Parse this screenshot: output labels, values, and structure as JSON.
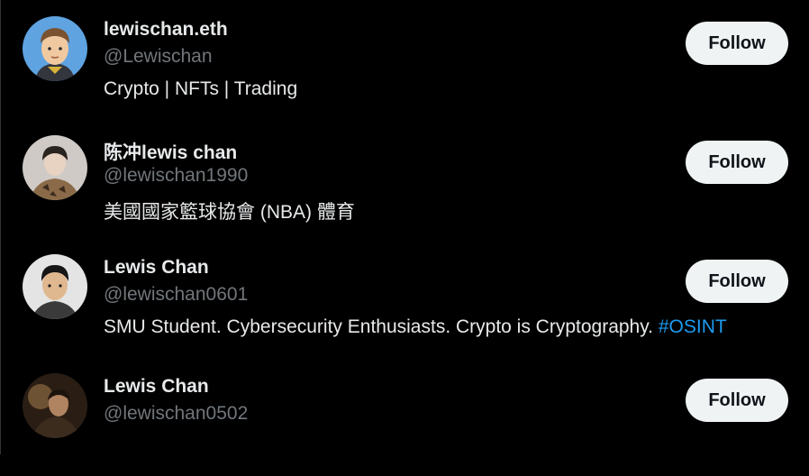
{
  "users": [
    {
      "display_name": "lewischan.eth",
      "handle": "@Lewischan",
      "bio": "Crypto | NFTs | Trading",
      "follow_label": "Follow"
    },
    {
      "display_name": "陈冲lewis chan",
      "handle": "@lewischan1990",
      "bio": "美國國家籃球協會 (NBA) 體育",
      "follow_label": "Follow"
    },
    {
      "display_name": "Lewis Chan",
      "handle": "@lewischan0601",
      "bio": "SMU Student. Cybersecurity Enthusiasts. Crypto is Cryptography. ",
      "bio_hashtag": "#OSINT",
      "follow_label": "Follow"
    },
    {
      "display_name": "Lewis Chan",
      "handle": "@lewischan0502",
      "follow_label": "Follow"
    }
  ],
  "colors": {
    "background": "#000000",
    "primary_text": "#e7e9ea",
    "secondary_text": "#71767b",
    "link": "#1d9bf0",
    "button_bg": "#eff3f4",
    "button_text": "#0f1419"
  }
}
